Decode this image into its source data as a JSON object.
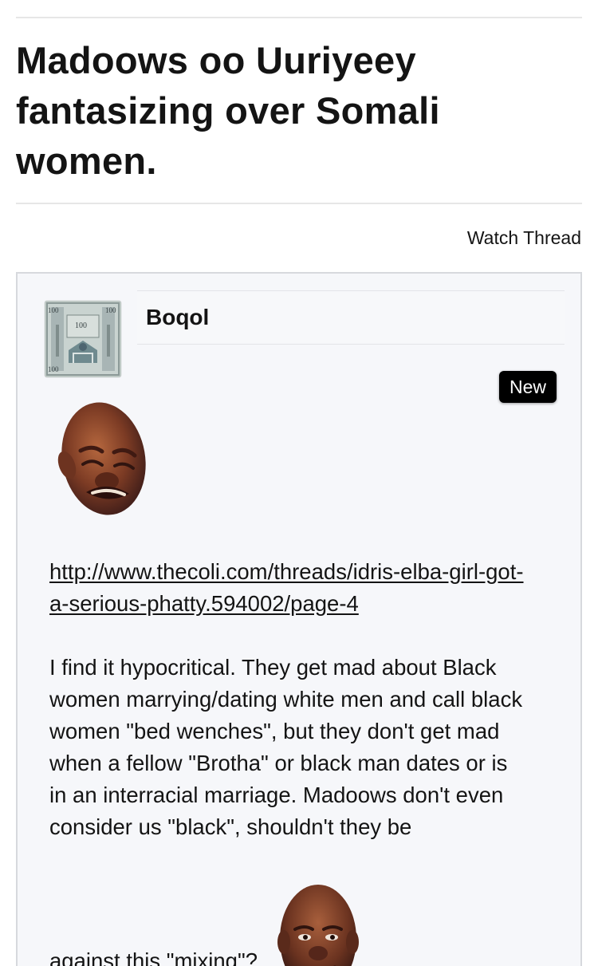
{
  "thread": {
    "title": "Madoows oo Uuriyeey fantasizing over Somali women.",
    "watch_label": "Watch Thread"
  },
  "post": {
    "author": "Boqol",
    "badge": "New",
    "avatar_icon": "somali-banknote-avatar",
    "reaction_icon_top": "crying-jordan-face-icon",
    "reaction_icon_bottom": "smirking-jordan-face-icon",
    "link_text": "http://www.thecoli.com/threads/idris-elba-girl-got-a-serious-phatty.594002/page-4",
    "body_text": "I find it hypocritical. They get mad about Black women marrying/dating white men and call black women \"bed wenches\", but they don't get mad when a fellow \"Brotha\" or black man dates or is in an interracial marriage. Madoows don't even consider us \"black\", shouldn't they be",
    "cutoff_text": "against this \"mixing\"?"
  },
  "colors": {
    "text": "#141414",
    "post_background": "#f6f7fa",
    "post_border": "#d7d9dd",
    "badge_background": "#000000",
    "badge_text": "#ffffff"
  }
}
